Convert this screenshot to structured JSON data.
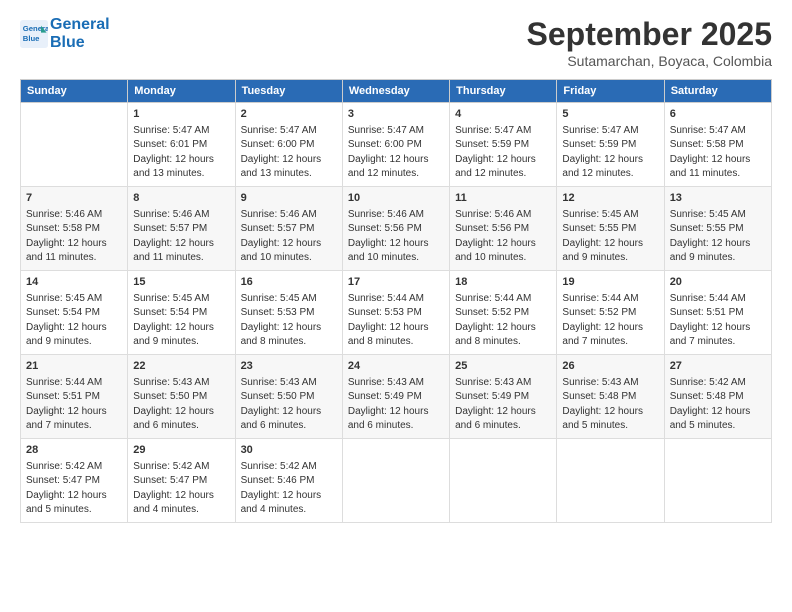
{
  "header": {
    "logo_line1": "General",
    "logo_line2": "Blue",
    "month": "September 2025",
    "location": "Sutamarchan, Boyaca, Colombia"
  },
  "weekdays": [
    "Sunday",
    "Monday",
    "Tuesday",
    "Wednesday",
    "Thursday",
    "Friday",
    "Saturday"
  ],
  "weeks": [
    [
      {
        "day": "",
        "info": ""
      },
      {
        "day": "1",
        "info": "Sunrise: 5:47 AM\nSunset: 6:01 PM\nDaylight: 12 hours\nand 13 minutes."
      },
      {
        "day": "2",
        "info": "Sunrise: 5:47 AM\nSunset: 6:00 PM\nDaylight: 12 hours\nand 13 minutes."
      },
      {
        "day": "3",
        "info": "Sunrise: 5:47 AM\nSunset: 6:00 PM\nDaylight: 12 hours\nand 12 minutes."
      },
      {
        "day": "4",
        "info": "Sunrise: 5:47 AM\nSunset: 5:59 PM\nDaylight: 12 hours\nand 12 minutes."
      },
      {
        "day": "5",
        "info": "Sunrise: 5:47 AM\nSunset: 5:59 PM\nDaylight: 12 hours\nand 12 minutes."
      },
      {
        "day": "6",
        "info": "Sunrise: 5:47 AM\nSunset: 5:58 PM\nDaylight: 12 hours\nand 11 minutes."
      }
    ],
    [
      {
        "day": "7",
        "info": "Sunrise: 5:46 AM\nSunset: 5:58 PM\nDaylight: 12 hours\nand 11 minutes."
      },
      {
        "day": "8",
        "info": "Sunrise: 5:46 AM\nSunset: 5:57 PM\nDaylight: 12 hours\nand 11 minutes."
      },
      {
        "day": "9",
        "info": "Sunrise: 5:46 AM\nSunset: 5:57 PM\nDaylight: 12 hours\nand 10 minutes."
      },
      {
        "day": "10",
        "info": "Sunrise: 5:46 AM\nSunset: 5:56 PM\nDaylight: 12 hours\nand 10 minutes."
      },
      {
        "day": "11",
        "info": "Sunrise: 5:46 AM\nSunset: 5:56 PM\nDaylight: 12 hours\nand 10 minutes."
      },
      {
        "day": "12",
        "info": "Sunrise: 5:45 AM\nSunset: 5:55 PM\nDaylight: 12 hours\nand 9 minutes."
      },
      {
        "day": "13",
        "info": "Sunrise: 5:45 AM\nSunset: 5:55 PM\nDaylight: 12 hours\nand 9 minutes."
      }
    ],
    [
      {
        "day": "14",
        "info": "Sunrise: 5:45 AM\nSunset: 5:54 PM\nDaylight: 12 hours\nand 9 minutes."
      },
      {
        "day": "15",
        "info": "Sunrise: 5:45 AM\nSunset: 5:54 PM\nDaylight: 12 hours\nand 9 minutes."
      },
      {
        "day": "16",
        "info": "Sunrise: 5:45 AM\nSunset: 5:53 PM\nDaylight: 12 hours\nand 8 minutes."
      },
      {
        "day": "17",
        "info": "Sunrise: 5:44 AM\nSunset: 5:53 PM\nDaylight: 12 hours\nand 8 minutes."
      },
      {
        "day": "18",
        "info": "Sunrise: 5:44 AM\nSunset: 5:52 PM\nDaylight: 12 hours\nand 8 minutes."
      },
      {
        "day": "19",
        "info": "Sunrise: 5:44 AM\nSunset: 5:52 PM\nDaylight: 12 hours\nand 7 minutes."
      },
      {
        "day": "20",
        "info": "Sunrise: 5:44 AM\nSunset: 5:51 PM\nDaylight: 12 hours\nand 7 minutes."
      }
    ],
    [
      {
        "day": "21",
        "info": "Sunrise: 5:44 AM\nSunset: 5:51 PM\nDaylight: 12 hours\nand 7 minutes."
      },
      {
        "day": "22",
        "info": "Sunrise: 5:43 AM\nSunset: 5:50 PM\nDaylight: 12 hours\nand 6 minutes."
      },
      {
        "day": "23",
        "info": "Sunrise: 5:43 AM\nSunset: 5:50 PM\nDaylight: 12 hours\nand 6 minutes."
      },
      {
        "day": "24",
        "info": "Sunrise: 5:43 AM\nSunset: 5:49 PM\nDaylight: 12 hours\nand 6 minutes."
      },
      {
        "day": "25",
        "info": "Sunrise: 5:43 AM\nSunset: 5:49 PM\nDaylight: 12 hours\nand 6 minutes."
      },
      {
        "day": "26",
        "info": "Sunrise: 5:43 AM\nSunset: 5:48 PM\nDaylight: 12 hours\nand 5 minutes."
      },
      {
        "day": "27",
        "info": "Sunrise: 5:42 AM\nSunset: 5:48 PM\nDaylight: 12 hours\nand 5 minutes."
      }
    ],
    [
      {
        "day": "28",
        "info": "Sunrise: 5:42 AM\nSunset: 5:47 PM\nDaylight: 12 hours\nand 5 minutes."
      },
      {
        "day": "29",
        "info": "Sunrise: 5:42 AM\nSunset: 5:47 PM\nDaylight: 12 hours\nand 4 minutes."
      },
      {
        "day": "30",
        "info": "Sunrise: 5:42 AM\nSunset: 5:46 PM\nDaylight: 12 hours\nand 4 minutes."
      },
      {
        "day": "",
        "info": ""
      },
      {
        "day": "",
        "info": ""
      },
      {
        "day": "",
        "info": ""
      },
      {
        "day": "",
        "info": ""
      }
    ]
  ]
}
